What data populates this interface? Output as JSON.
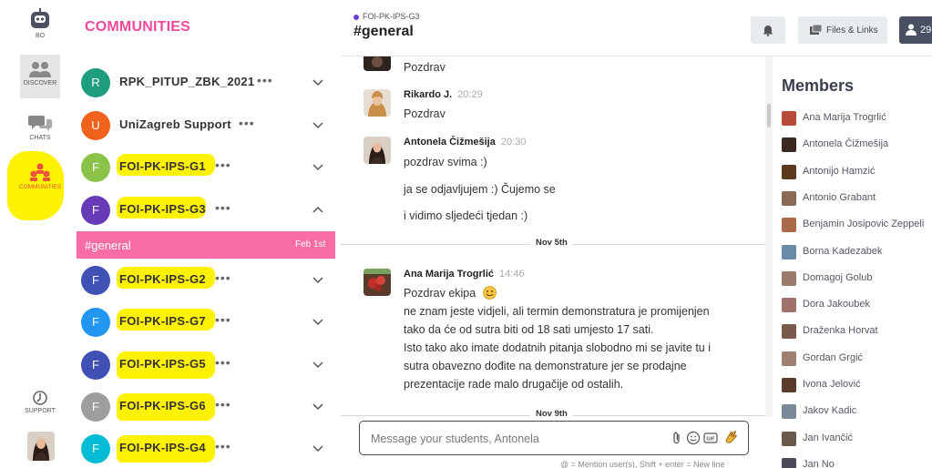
{
  "rail": {
    "bo_label": "BO",
    "discover_label": "DISCOVER",
    "chats_label": "CHATS",
    "communities_label": "COMMUNITIES",
    "support_label": "SUPPORT",
    "communities_color": "#e8533b",
    "highlight_color": "#fff200"
  },
  "communities": {
    "title": "COMMUNITIES",
    "title_color": "#ee4a9c",
    "items": [
      {
        "initial": "R",
        "name": "RPK_PITUP_ZBK_2021",
        "color": "#1e9e7e",
        "expanded": false
      },
      {
        "initial": "U",
        "name": "UniZagreb Support",
        "color": "#f1631d",
        "expanded": false
      },
      {
        "initial": "F",
        "name": "FOI-PK-IPS-G1",
        "color": "#8bc34a",
        "expanded": false
      },
      {
        "initial": "F",
        "name": "FOI-PK-IPS-G3",
        "color": "#673ab7",
        "expanded": true
      },
      {
        "initial": "F",
        "name": "FOI-PK-IPS-G2",
        "color": "#3f51b5",
        "expanded": false
      },
      {
        "initial": "F",
        "name": "FOI-PK-IPS-G7",
        "color": "#2196f3",
        "expanded": false
      },
      {
        "initial": "F",
        "name": "FOI-PK-IPS-G5",
        "color": "#3f51b5",
        "expanded": false
      },
      {
        "initial": "F",
        "name": "FOI-PK-IPS-G6",
        "color": "#9e9e9e",
        "expanded": false
      },
      {
        "initial": "F",
        "name": "FOI-PK-IPS-G4",
        "color": "#00bcd4",
        "expanded": false
      }
    ],
    "dots": "•••",
    "active_channel": {
      "name": "#general",
      "date": "Feb 1st",
      "color": "#f96da4"
    }
  },
  "header": {
    "breadcrumb": "FOI-PK-IPS-G3",
    "title": "#general",
    "files_label": "Files & Links",
    "members_count": "29"
  },
  "messages": {
    "m0": {
      "lines": [
        "Pozdrav"
      ]
    },
    "m1": {
      "author": "Rikardo J.",
      "time": "20:29",
      "lines": [
        "Pozdrav"
      ]
    },
    "m2": {
      "author": "Antonela Čižmešija",
      "time": "20:30",
      "lines": [
        "pozdrav svima :)",
        "ja se odjavljujem :) Čujemo se",
        "i vidimo sljedeći tjedan :)"
      ]
    },
    "div1": "Nov 5th",
    "m3": {
      "author": "Ana Marija Trogrlić",
      "time": "14:46",
      "lines": [
        "Pozdrav ekipa",
        "ne znam jeste vidjeli, ali termin demonstratura je promijenjen",
        "tako da će od sutra biti od 18 sati umjesto 17 sati.",
        "Isto tako ako imate dodatnih pitanja slobodno mi se javite tu i",
        "sutra obavezno dođite na demonstrature jer se prodajne",
        "prezentacije rade malo drugačije od ostalih."
      ]
    },
    "div2": "Nov 9th"
  },
  "composer": {
    "placeholder": "Message your students, Antonela",
    "hint": "@ = Mention user(s), Shift + enter = New line"
  },
  "members": {
    "title": "Members",
    "list": [
      "Ana Marija Trogrlić",
      "Antonela Čižmešija",
      "Antonijo Hamzić",
      "Antonio Grabant",
      "Benjamin Josipovic Zeppeli",
      "Borna Kadezabek",
      "Domagoj Golub",
      "Dora Jakoubek",
      "Draženka Horvat",
      "Gordan Grgić",
      "Ivona Jelović",
      "Jakov Kadic",
      "Jan Ivančić",
      "Jan No"
    ]
  }
}
